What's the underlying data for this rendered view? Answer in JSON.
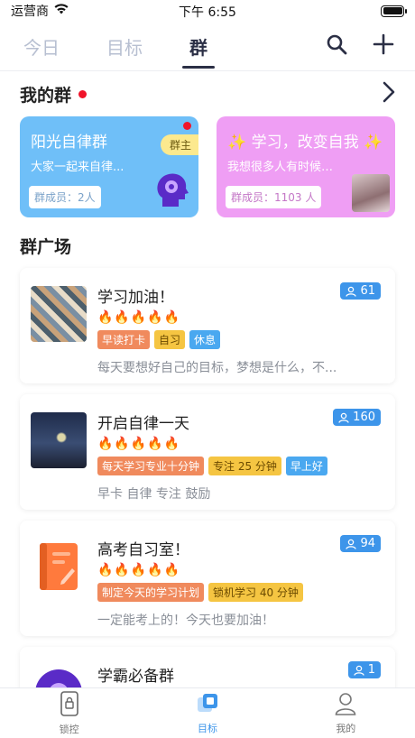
{
  "status": {
    "carrier": "运营商",
    "time": "下午 6:55"
  },
  "nav": {
    "tabs": [
      {
        "label": "今日"
      },
      {
        "label": "目标"
      },
      {
        "label": "群"
      }
    ]
  },
  "my_groups": {
    "title": "我的群",
    "cards": [
      {
        "title": "阳光自律群",
        "desc": "大家一起来自律...",
        "members": "群成员：2人",
        "badge": "群主"
      },
      {
        "title": "✨ 学习，改变自我 ✨",
        "desc": "我想很多人有时候其实...",
        "members": "群成员：1103 人"
      }
    ]
  },
  "square": {
    "title": "群广场",
    "groups": [
      {
        "title": "学习加油！",
        "count": "61",
        "flames": "🔥🔥🔥🔥🔥",
        "tags": [
          {
            "label": "早读打卡",
            "color": "orange"
          },
          {
            "label": "自习",
            "color": "yellow"
          },
          {
            "label": "休息",
            "color": "blue"
          }
        ],
        "desc": "每天要想好自己的目标，梦想是什么，不..."
      },
      {
        "title": "开启自律一天",
        "count": "160",
        "flames": "🔥🔥🔥🔥🔥",
        "tags": [
          {
            "label": "每天学习专业十分钟",
            "color": "orange"
          },
          {
            "label": "专注 25 分钟",
            "color": "yellow"
          },
          {
            "label": "早上好",
            "color": "blue"
          }
        ],
        "desc": "早卡 自律 专注 鼓励"
      },
      {
        "title": "高考自习室！",
        "count": "94",
        "flames": "🔥🔥🔥🔥🔥",
        "tags": [
          {
            "label": "制定今天的学习计划",
            "color": "orange"
          },
          {
            "label": "锁机学习 40 分钟",
            "color": "yellow"
          }
        ],
        "desc": "一定能考上的！今天也要加油！"
      },
      {
        "title": "学霸必备群",
        "count": "1",
        "flames": "🔥🔥🔥🔥🔥",
        "tags": [],
        "desc": ""
      }
    ]
  },
  "bottom_tabs": [
    {
      "label": "锁控"
    },
    {
      "label": "目标"
    },
    {
      "label": "我的"
    }
  ],
  "colors": {
    "accent": "#3d95ea",
    "card_blue": "#6fbff8",
    "card_pink": "#ef9ef4",
    "badge_red": "#f0142a"
  }
}
